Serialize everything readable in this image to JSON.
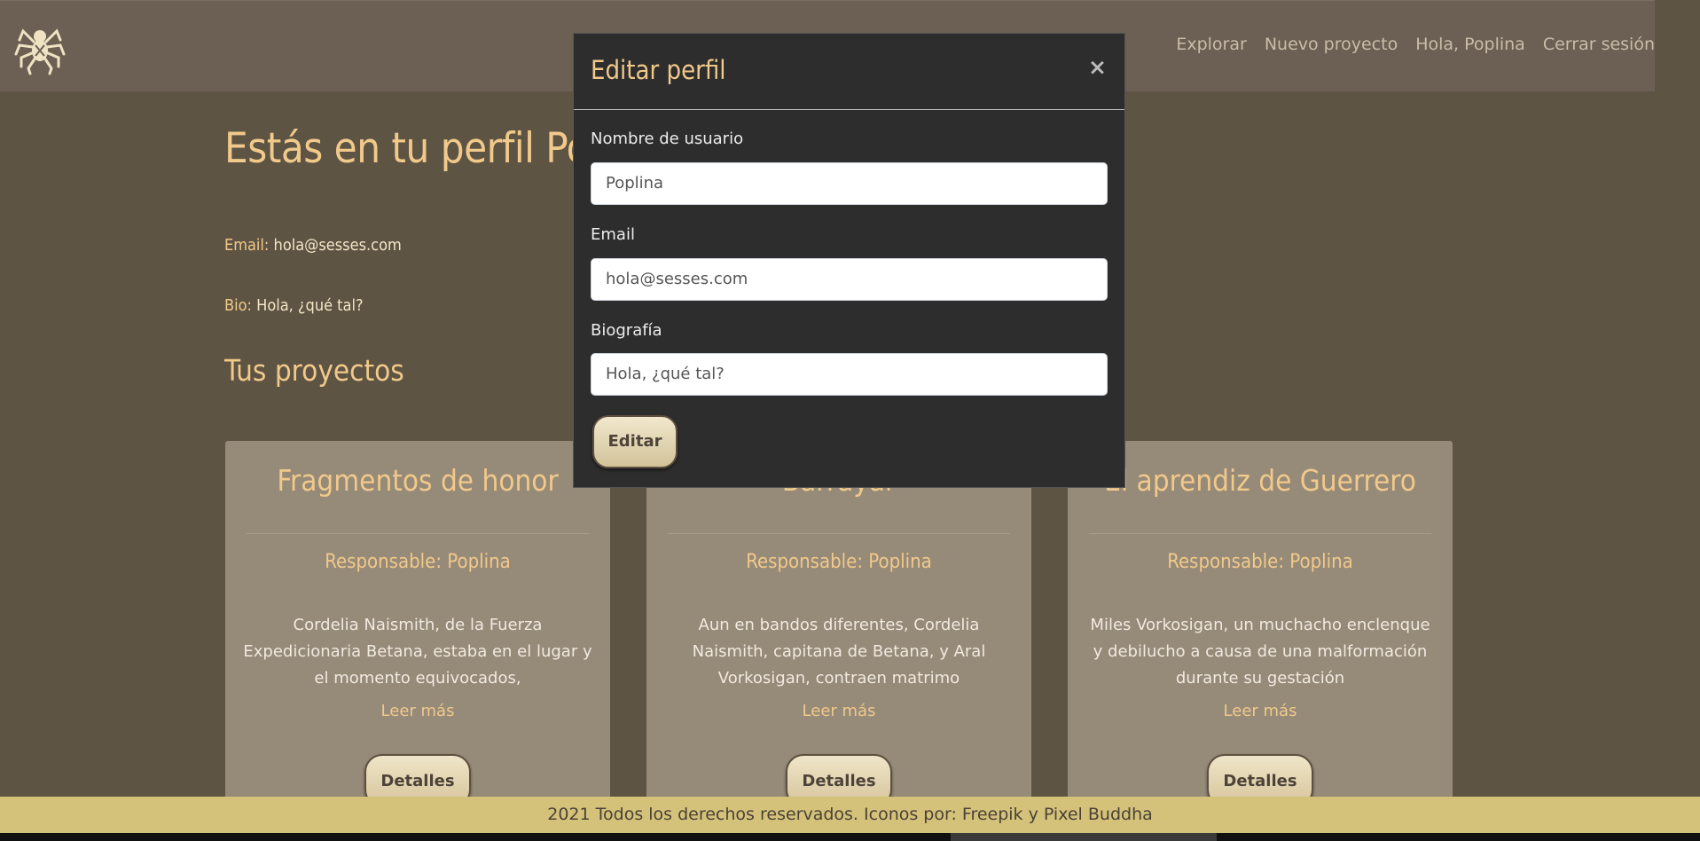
{
  "nav": {
    "logo_icon": "spider-logo-icon",
    "links": [
      "Explorar",
      "Nuevo proyecto",
      "Hola, Poplina",
      "Cerrar sesión"
    ]
  },
  "profile": {
    "title": "Estás en tu perfil Poplina",
    "email_label": "Email:",
    "email_value": "hola@sesses.com",
    "bio_label": "Bio:",
    "bio_value": "Hola, ¿qué tal?",
    "projects_title": "Tus proyectos"
  },
  "projects": [
    {
      "title": "Fragmentos de honor",
      "responsible": "Responsable: Poplina",
      "description": "Cordelia Naismith, de la Fuerza Expedicionaria Betana, estaba en el lugar y el momento equivocados,",
      "more": "Leer más",
      "button": "Detalles"
    },
    {
      "title": "Barrayar",
      "responsible": "Responsable: Poplina",
      "description": "Aun en bandos diferentes, Cordelia Naismith, capitana de Betana, y Aral Vorkosigan, contraen matrimo",
      "more": "Leer más",
      "button": "Detalles"
    },
    {
      "title": "El aprendiz de Guerrero",
      "responsible": "Responsable: Poplina",
      "description": "Miles Vorkosigan, un muchacho enclenque y debilucho a causa de una malformación durante su gestación",
      "more": "Leer más",
      "button": "Detalles"
    }
  ],
  "modal": {
    "title": "Editar perfil",
    "close": "×",
    "username_label": "Nombre de usuario",
    "username_value": "Poplina",
    "email_label": "Email",
    "email_value": "hola@sesses.com",
    "bio_label": "Biografía",
    "bio_value": "Hola, ¿qué tal?",
    "submit": "Editar"
  },
  "footer": {
    "text": "2021 Todos los derechos reservados. Iconos por: Freepik y Pixel Buddha"
  },
  "colors": {
    "page_bg": "#5e5444",
    "navbar_bg": "#6b6053",
    "accent": "#f1c98a",
    "card_bg": "#968a79",
    "modal_bg": "#2d2d2d",
    "footer_bg": "#d4c27a"
  }
}
